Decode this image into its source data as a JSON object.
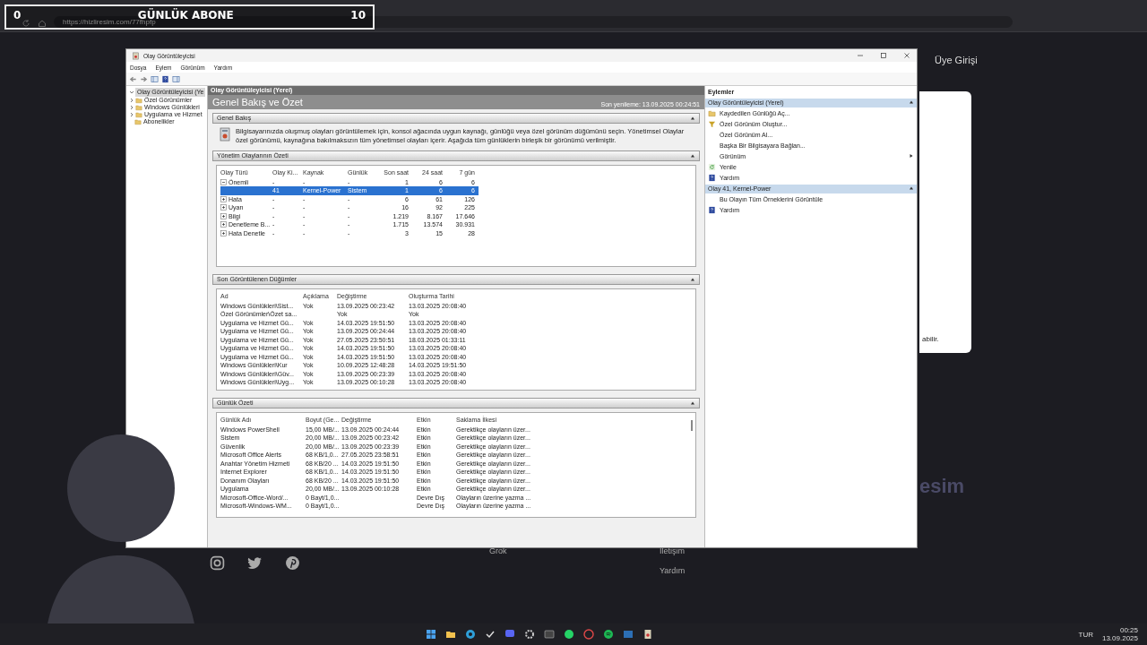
{
  "overlay": {
    "left_count": "0",
    "title": "GÜNLÜK ABONE",
    "right_count": "10"
  },
  "browser": {
    "url": "https://hizliresim.com/77fhpfp"
  },
  "web_page": {
    "login": "Üye Girişi",
    "dialog_text": "abilir.",
    "logo_fragment": "esim",
    "footer_links": [
      "Grok",
      "İletişim",
      "Yardım"
    ]
  },
  "event_viewer": {
    "title": "Olay Görüntüleyicisi",
    "menu": [
      "Dosya",
      "Eylem",
      "Görünüm",
      "Yardım"
    ],
    "tree": [
      {
        "label": "Olay Görüntüleyicisi (Ye",
        "selected": true,
        "expanded": true,
        "children": [
          {
            "label": "Özel Görünümler",
            "selected": false,
            "expanded": false
          },
          {
            "label": "Windows Günlükleri",
            "selected": false,
            "expanded": false
          },
          {
            "label": "Uygulama ve Hizmet",
            "selected": false,
            "expanded": false
          },
          {
            "label": "Abonelikler",
            "selected": false
          }
        ]
      }
    ],
    "header": "Olay Görüntüleyicisi (Yerel)",
    "page_title": "Genel Bakış ve Özet",
    "last_refresh": "Son yenileme: 13.09.2025 00:24:51",
    "overview": {
      "title": "Genel Bakış",
      "text": "Bilgisayarınızda oluşmuş olayları görüntülemek için, konsol ağacında uygun kaynağı, günlüğü veya özel görünüm düğümünü seçin. Yönetimsel Olaylar özel görünümü, kaynağına bakılmaksızın tüm yönetimsel olayları içerir. Aşağıda tüm günlüklerin birleşik bir görünümü verilmiştir."
    },
    "admin_summary": {
      "title": "Yönetim Olaylarının Özeti",
      "columns": [
        "Olay Türü",
        "Olay Ki...",
        "Kaynak",
        "Günlük",
        "Son saat",
        "24 saat",
        "7 gün"
      ],
      "rows": [
        {
          "label": "Önemli",
          "values": [
            "-",
            "-",
            "-",
            "1",
            "6",
            "6"
          ],
          "expanded": true,
          "selected": false,
          "children": [
            {
              "values": [
                "41",
                "Kernel-Power",
                "Sistem",
                "1",
                "6",
                "6"
              ],
              "selected": true
            }
          ]
        },
        {
          "label": "Hata",
          "values": [
            "-",
            "-",
            "-",
            "6",
            "61",
            "126"
          ],
          "expanded": false,
          "selected": false
        },
        {
          "label": "Uyarı",
          "values": [
            "-",
            "-",
            "-",
            "16",
            "92",
            "225"
          ],
          "expanded": false,
          "selected": false
        },
        {
          "label": "Bilgi",
          "values": [
            "-",
            "-",
            "-",
            "1.219",
            "8.167",
            "17.646"
          ],
          "expanded": false,
          "selected": false
        },
        {
          "label": "Denetleme B...",
          "values": [
            "-",
            "-",
            "-",
            "1.715",
            "13.574",
            "30.931"
          ],
          "expanded": false,
          "selected": false
        },
        {
          "label": "Hata Denetle",
          "values": [
            "-",
            "-",
            "-",
            "3",
            "15",
            "28"
          ],
          "expanded": false,
          "selected": false
        }
      ]
    },
    "recent_nodes": {
      "title": "Son Görüntülenen Düğümler",
      "columns": [
        "Ad",
        "Açıklama",
        "Değiştirme",
        "Oluşturma Tarihi"
      ],
      "rows": [
        {
          "name": "Windows Günlükleri\\Sist...",
          "description": "Yok",
          "modified": "13.09.2025 00:23:42",
          "created": "13.03.2025 20:08:40"
        },
        {
          "name": "Özel Görünümler\\Özet sa...",
          "modified": "Yok",
          "created": "Yok"
        },
        {
          "name": "Uygulama ve Hizmet Gü...",
          "description": "Yok",
          "modified": "14.03.2025 19:51:50",
          "created": "13.03.2025 20:08:40"
        },
        {
          "name": "Uygulama ve Hizmet Gü...",
          "description": "Yok",
          "modified": "13.09.2025 00:24:44",
          "created": "13.03.2025 20:08:40"
        },
        {
          "name": "Uygulama ve Hizmet Gü...",
          "description": "Yok",
          "modified": "27.05.2025 23:50:51",
          "created": "18.03.2025 01:33:11"
        },
        {
          "name": "Uygulama ve Hizmet Gü...",
          "description": "Yok",
          "modified": "14.03.2025 19:51:50",
          "created": "13.03.2025 20:08:40"
        },
        {
          "name": "Uygulama ve Hizmet Gü...",
          "description": "Yok",
          "modified": "14.03.2025 19:51:50",
          "created": "13.03.2025 20:08:40"
        },
        {
          "name": "Windows Günlükleri\\Kur",
          "description": "Yok",
          "modified": "10.09.2025 12:48:28",
          "created": "14.03.2025 19:51:50"
        },
        {
          "name": "Windows Günlükleri\\Güv...",
          "description": "Yok",
          "modified": "13.09.2025 00:23:39",
          "created": "13.03.2025 20:08:40"
        },
        {
          "name": "Windows Günlükleri\\Uyg...",
          "description": "Yok",
          "modified": "13.09.2025 00:10:28",
          "created": "13.03.2025 20:08:40"
        }
      ]
    },
    "log_summary": {
      "title": "Günlük Özeti",
      "columns": [
        "Günlük Adı",
        "Boyut (Ge...",
        "Değiştirme",
        "Etkin",
        "Saklama İlkesi"
      ],
      "rows": [
        [
          "Windows PowerShell",
          "15,00 MB/...",
          "13.09.2025 00:24:44",
          "Etkin",
          "Gerektikçe olayların üzer..."
        ],
        [
          "Sistem",
          "20,00 MB/...",
          "13.09.2025 00:23:42",
          "Etkin",
          "Gerektikçe olayların üzer..."
        ],
        [
          "Güvenlik",
          "20,00 MB/...",
          "13.09.2025 00:23:39",
          "Etkin",
          "Gerektikçe olayların üzer..."
        ],
        [
          "Microsoft Office Alerts",
          "68 KB/1,0...",
          "27.05.2025 23:58:51",
          "Etkin",
          "Gerektikçe olayların üzer..."
        ],
        [
          "Anahtar Yönetim Hizmeti",
          "68 KB/20 ...",
          "14.03.2025 19:51:50",
          "Etkin",
          "Gerektikçe olayların üzer..."
        ],
        [
          "Internet Explorer",
          "68 KB/1,0...",
          "14.03.2025 19:51:50",
          "Etkin",
          "Gerektikçe olayların üzer..."
        ],
        [
          "Donanım Olayları",
          "68 KB/20 ...",
          "14.03.2025 19:51:50",
          "Etkin",
          "Gerektikçe olayların üzer..."
        ],
        [
          "Uygulama",
          "20,00 MB/...",
          "13.09.2025 00:10:28",
          "Etkin",
          "Gerektikçe olayların üzer..."
        ],
        [
          "Microsoft-Office-Word/...",
          "0 Bayt/1,0...",
          null,
          "Devre Dış",
          "Olayların üzerine yazma ..."
        ],
        [
          "Microsoft-Windows-WM...",
          "0 Bayt/1,0...",
          null,
          "Devre Dış",
          "Olayların üzerine yazma ..."
        ]
      ]
    },
    "actions": {
      "title": "Eylemler",
      "groups": [
        {
          "title": "Olay Görüntüleyicisi (Yerel)",
          "items": [
            {
              "label": "Kaydedilen Günlüğü Aç...",
              "kind": "folder"
            },
            {
              "label": "Özel Görünüm Oluştur...",
              "kind": "filter"
            },
            {
              "label": "Özel Görünüm Al..."
            },
            {
              "label": "Başka Bir Bilgisayara Bağlan..."
            },
            {
              "label": "Görünüm",
              "submenu": true
            },
            {
              "label": "Yenile",
              "kind": "refresh"
            },
            {
              "label": "Yardım",
              "kind": "help"
            }
          ]
        },
        {
          "title": "Olay 41, Kernel-Power",
          "items": [
            {
              "label": "Bu Olayın Tüm Örneklerini Görüntüle"
            },
            {
              "label": "Yardım",
              "kind": "help"
            }
          ]
        }
      ]
    }
  },
  "taskbar": {
    "language": "TUR",
    "time": "00:25",
    "date": "13.09.2025"
  }
}
